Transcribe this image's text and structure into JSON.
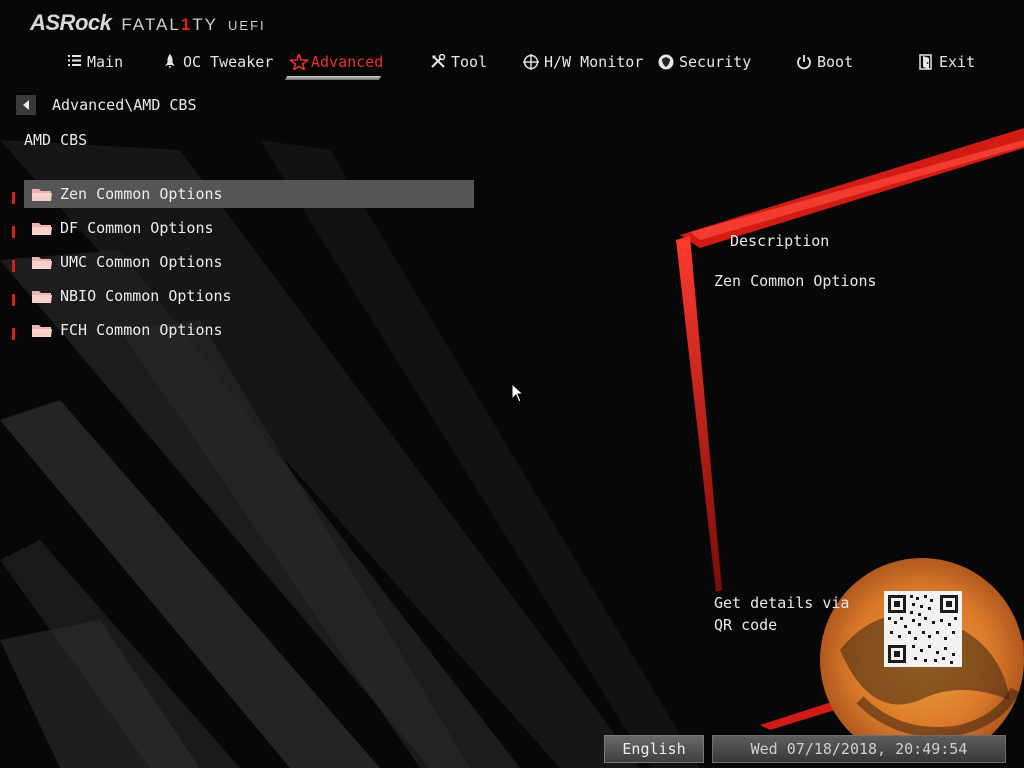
{
  "brand": {
    "logo": "ASRock",
    "line_prefix": "FATAL",
    "line_accent": "1",
    "line_suffix": "TY",
    "uefi": "UEFI"
  },
  "nav": {
    "tabs": [
      {
        "label": "Main",
        "icon": "list-icon",
        "active": false
      },
      {
        "label": "OC Tweaker",
        "icon": "rocket-icon",
        "active": false
      },
      {
        "label": "Advanced",
        "icon": "star-icon",
        "active": true
      },
      {
        "label": "Tool",
        "icon": "tools-icon",
        "active": false
      },
      {
        "label": "H/W Monitor",
        "icon": "crosshair-icon",
        "active": false
      },
      {
        "label": "Security",
        "icon": "shield-icon",
        "active": false
      },
      {
        "label": "Boot",
        "icon": "power-icon",
        "active": false
      },
      {
        "label": "Exit",
        "icon": "exit-door-icon",
        "active": false
      }
    ]
  },
  "breadcrumb": {
    "path": "Advanced\\AMD CBS"
  },
  "page": {
    "title": "AMD CBS"
  },
  "menu": {
    "items": [
      {
        "label": "Zen Common Options",
        "selected": true
      },
      {
        "label": "DF Common Options",
        "selected": false
      },
      {
        "label": "UMC Common Options",
        "selected": false
      },
      {
        "label": "NBIO Common Options",
        "selected": false
      },
      {
        "label": "FCH Common Options",
        "selected": false
      }
    ]
  },
  "description": {
    "title": "Description",
    "text": "Zen Common Options"
  },
  "qr": {
    "text": "Get details via QR code"
  },
  "footer": {
    "language": "English",
    "datetime": "Wed 07/18/2018, 20:49:54"
  },
  "colors": {
    "accent": "#e8312a",
    "selected_bg": "#555555",
    "folder": "#f0b4b0"
  }
}
